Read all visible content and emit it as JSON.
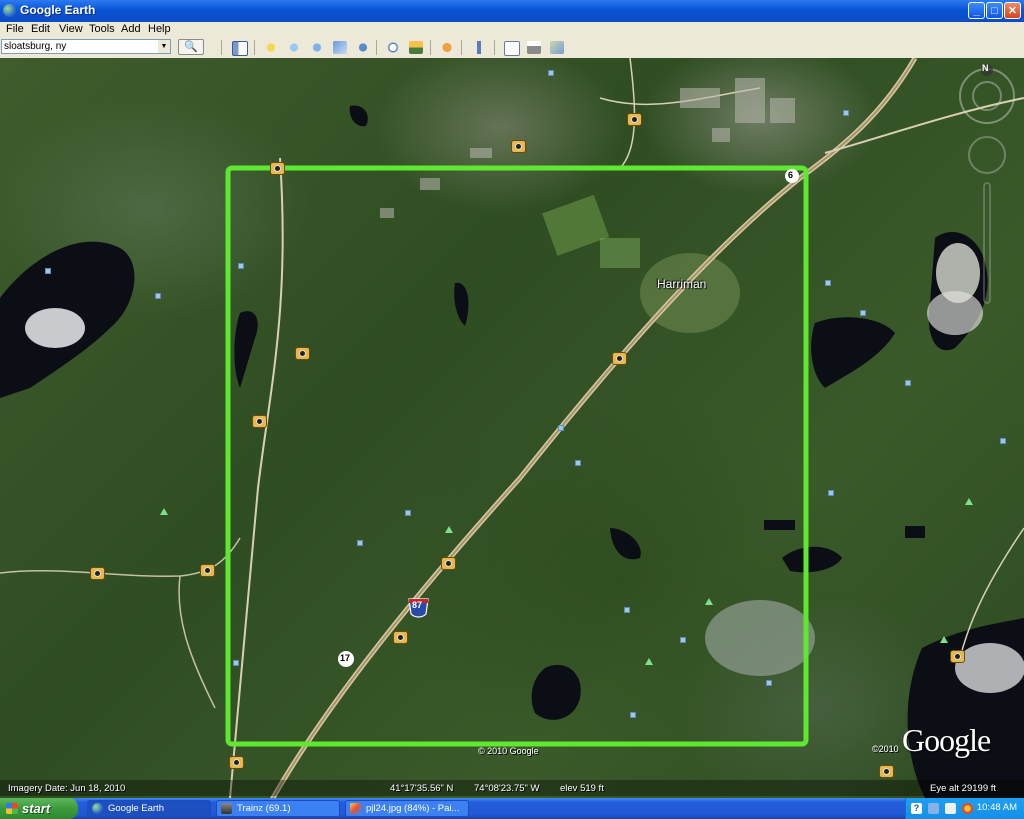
{
  "window": {
    "title": "Google Earth",
    "controls": {
      "minimize": "_",
      "maximize": "□",
      "close": "✕"
    }
  },
  "menu": [
    "File",
    "Edit",
    "View",
    "Tools",
    "Add",
    "Help"
  ],
  "search": {
    "value": "sloatsburg, ny"
  },
  "map": {
    "place_label": "Harriman",
    "route_labels": {
      "interstate": "87",
      "route17": "17",
      "route6": "6"
    },
    "compass": "N",
    "copyright_center": "© 2010 Google",
    "copyright_right": "©2010",
    "logo": "Google",
    "highlight_color": "#5ee830"
  },
  "status": {
    "imagery_date": "Imagery Date: Jun 18, 2010",
    "lat": "41°17'35.56\" N",
    "lon": "74°08'23.75\" W",
    "elev": "elev  519 ft",
    "eye_alt": "Eye alt  29199 ft"
  },
  "taskbar": {
    "start": "start",
    "tasks": [
      {
        "label": "Google Earth",
        "icon": "google-earth-icon"
      },
      {
        "label": "Trainz  (69.1)",
        "icon": "trainz-icon"
      },
      {
        "label": "pjl24.jpg (84%) - Pai...",
        "icon": "paint-icon"
      }
    ],
    "clock": "10:48 AM"
  }
}
